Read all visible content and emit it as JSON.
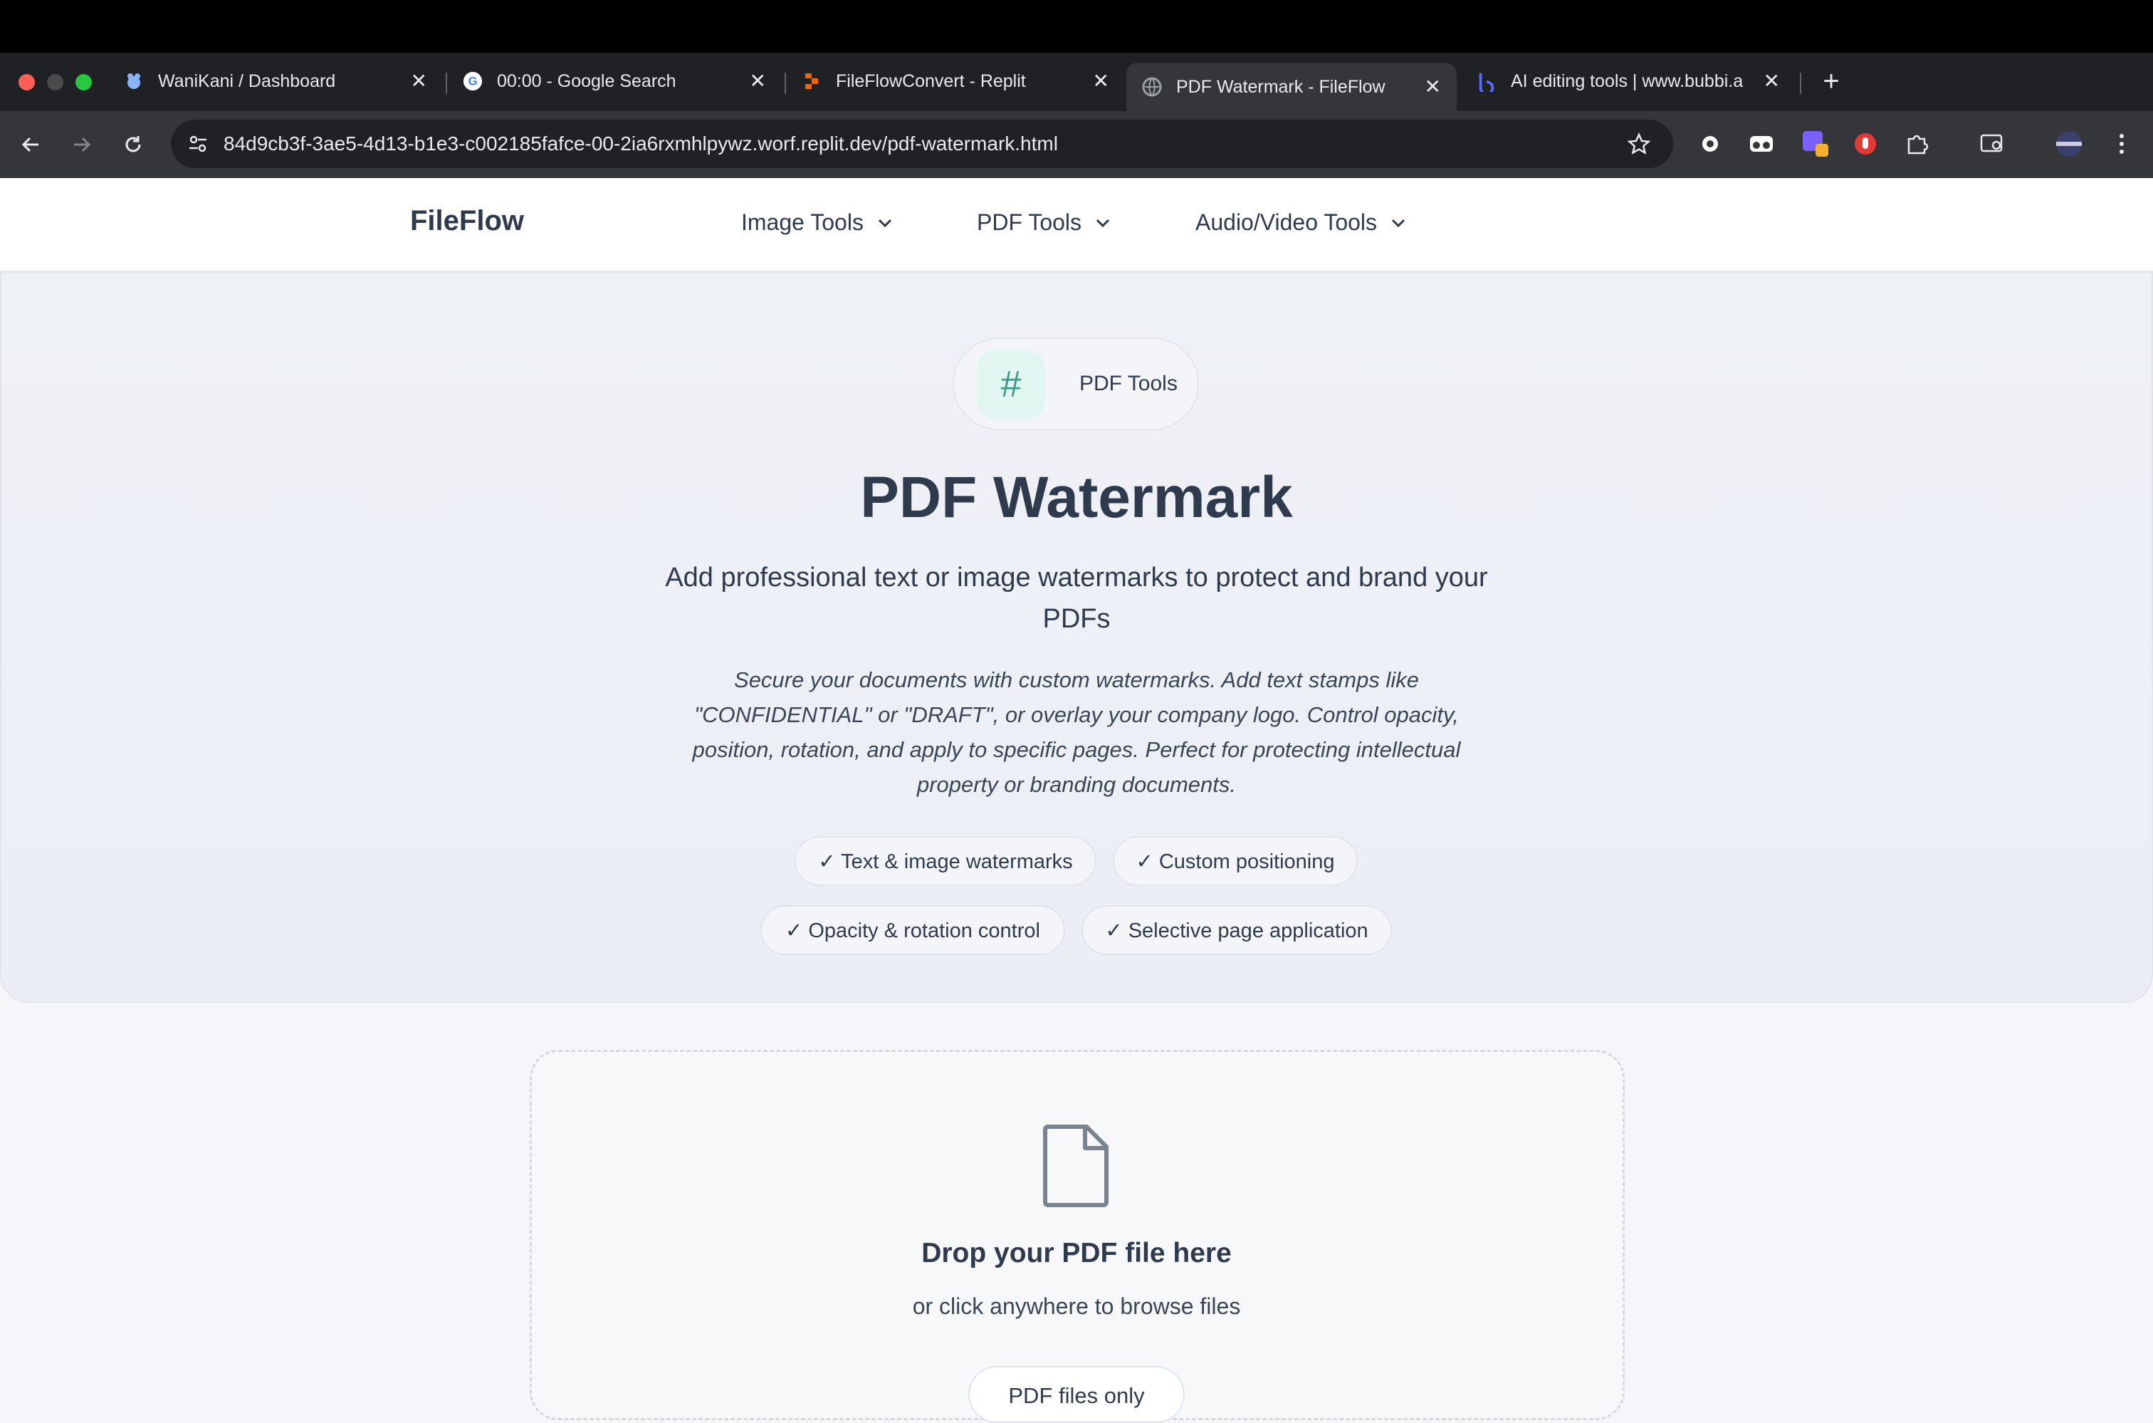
{
  "browser": {
    "tabs": [
      {
        "title": "WaniKani / Dashboard",
        "favicon": "wanikani-icon"
      },
      {
        "title": "00:00 - Google Search",
        "favicon": "google-icon"
      },
      {
        "title": "FileFlowConvert - Replit",
        "favicon": "replit-icon"
      },
      {
        "title": "PDF Watermark - FileFlow",
        "favicon": "globe-icon",
        "active": true
      },
      {
        "title": "AI editing tools | www.bubbi.a",
        "favicon": "bubbi-icon"
      }
    ],
    "close_glyph": "✕",
    "new_tab_glyph": "+",
    "url": "84d9cb3f-3ae5-4d13-b1e3-c002185fafce-00-2ia6rxmhlpywz.worf.replit.dev/pdf-watermark.html"
  },
  "site": {
    "brand": "FileFlow",
    "nav": [
      "Image Tools",
      "PDF Tools",
      "Audio/Video Tools"
    ]
  },
  "hero": {
    "category_icon": "#",
    "category": "PDF Tools",
    "title": "PDF Watermark",
    "subtitle": "Add professional text or image watermarks to protect and brand your PDFs",
    "description": "Secure your documents with custom watermarks. Add text stamps like \"CONFIDENTIAL\" or \"DRAFT\", or overlay your company logo. Control opacity, position, rotation, and apply to specific pages. Perfect for protecting intellectual property or branding documents.",
    "features": [
      "✓ Text & image watermarks",
      "✓ Custom positioning",
      "✓ Opacity & rotation control",
      "✓ Selective page application"
    ]
  },
  "upload": {
    "title": "Drop your PDF file here",
    "subtitle": "or click anywhere to browse files",
    "pill": "PDF files only"
  },
  "colors": {
    "text": "#2f3b4c",
    "accent_teal": "#3d9a86",
    "chrome_dark": "#202124"
  }
}
